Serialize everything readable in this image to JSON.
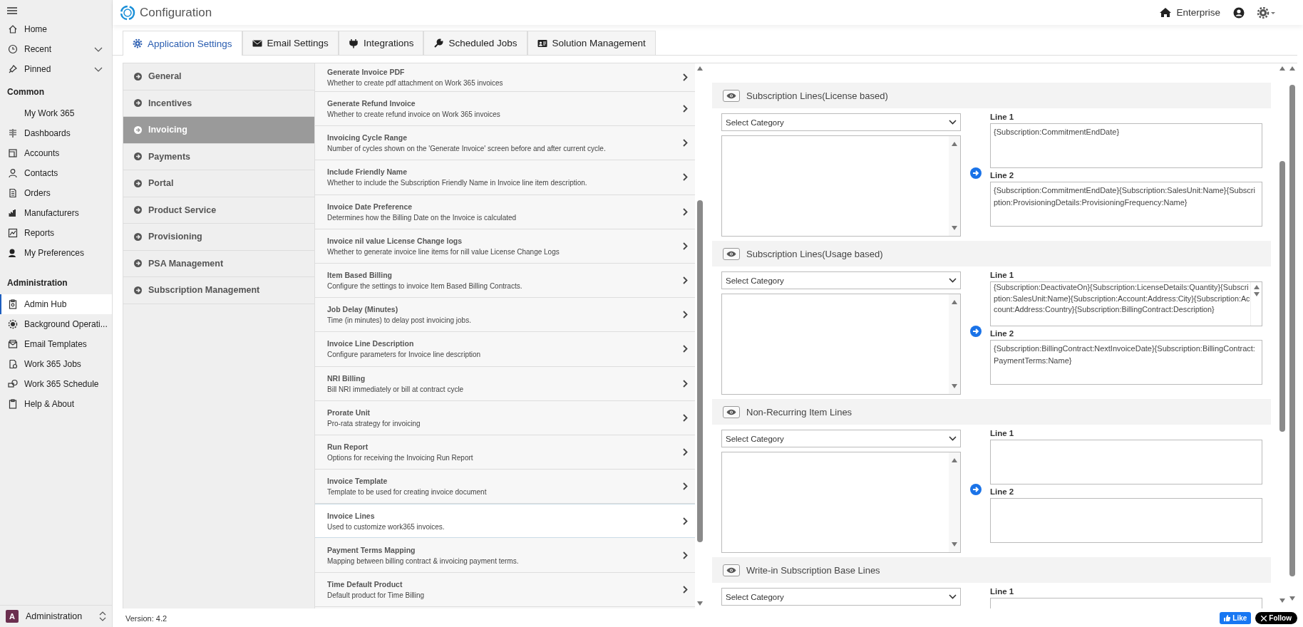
{
  "sidebar": {
    "top_items": [
      {
        "label": "Home"
      },
      {
        "label": "Recent",
        "expanded": false
      },
      {
        "label": "Pinned",
        "expanded": false
      }
    ],
    "groups": [
      {
        "title": "Common",
        "items": [
          {
            "label": "My Work 365",
            "selected": false
          },
          {
            "label": "Dashboards",
            "selected": false
          },
          {
            "label": "Accounts",
            "selected": false
          },
          {
            "label": "Contacts",
            "selected": false
          },
          {
            "label": "Orders",
            "selected": false
          },
          {
            "label": "Manufacturers",
            "selected": false
          },
          {
            "label": "Reports",
            "selected": false
          },
          {
            "label": "My Preferences",
            "selected": false
          }
        ]
      },
      {
        "title": "Administration",
        "items": [
          {
            "label": "Admin Hub",
            "selected": true
          },
          {
            "label": "Background Operati...",
            "selected": false
          },
          {
            "label": "Email Templates",
            "selected": false
          },
          {
            "label": "Work 365 Jobs",
            "selected": false
          },
          {
            "label": "Work 365 Schedule",
            "selected": false
          },
          {
            "label": "Help & About",
            "selected": false
          }
        ]
      }
    ],
    "area": {
      "initial": "A",
      "label": "Administration"
    }
  },
  "header": {
    "title": "Configuration",
    "environment": "Enterprise"
  },
  "tabs": [
    {
      "label": "Application Settings",
      "selected": true
    },
    {
      "label": "Email Settings",
      "selected": false
    },
    {
      "label": "Integrations",
      "selected": false
    },
    {
      "label": "Scheduled Jobs",
      "selected": false
    },
    {
      "label": "Solution Management",
      "selected": false
    }
  ],
  "categories": [
    {
      "label": "General",
      "selected": false
    },
    {
      "label": "Incentives",
      "selected": false
    },
    {
      "label": "Invoicing",
      "selected": true
    },
    {
      "label": "Payments",
      "selected": false
    },
    {
      "label": "Portal",
      "selected": false
    },
    {
      "label": "Product Service",
      "selected": false
    },
    {
      "label": "Provisioning",
      "selected": false
    },
    {
      "label": "PSA Management",
      "selected": false
    },
    {
      "label": "Subscription Management",
      "selected": false
    }
  ],
  "settings": [
    {
      "title": "Generate Invoice PDF",
      "description": "Whether to create pdf attachment on Work 365 invoices",
      "selected": false
    },
    {
      "title": "Generate Refund Invoice",
      "description": "Whether to create refund invoice on Work 365 invoices",
      "selected": false
    },
    {
      "title": "Invoicing Cycle Range",
      "description": "Number of cycles shown on the 'Generate Invoice' screen before and after current cycle.",
      "selected": false
    },
    {
      "title": "Include Friendly Name",
      "description": "Whether to include the Subscription Friendly Name in Invoice line item description.",
      "selected": false
    },
    {
      "title": "Invoice Date Preference",
      "description": "Determines how the Billing Date on the Invoice is calculated",
      "selected": false
    },
    {
      "title": "Invoice nil value License Change logs",
      "description": "Whether to generate invoice line items for nill value License Change Logs",
      "selected": false
    },
    {
      "title": "Item Based Billing",
      "description": "Configure the settings to invoice Item Based Billing Contracts.",
      "selected": false
    },
    {
      "title": "Job Delay (Minutes)",
      "description": "Time (in minutes) to delay post invoicing jobs.",
      "selected": false
    },
    {
      "title": "Invoice Line Description",
      "description": "Configure parameters for Invoice line description",
      "selected": false
    },
    {
      "title": "NRI Billing",
      "description": "Bill NRI immediately or bill at contract cycle",
      "selected": false
    },
    {
      "title": "Prorate Unit",
      "description": "Pro-rata strategy for invoicing",
      "selected": false
    },
    {
      "title": "Run Report",
      "description": "Options for receiving the Invoicing Run Report",
      "selected": false
    },
    {
      "title": "Invoice Template",
      "description": "Template to be used for creating invoice document",
      "selected": false
    },
    {
      "title": "Invoice Lines",
      "description": "Used to customize work365 invoices.",
      "selected": true
    },
    {
      "title": "Payment Terms Mapping",
      "description": "Mapping between billing contract & invoicing payment terms.",
      "selected": false
    },
    {
      "title": "Time Default Product",
      "description": "Default product for Time Billing",
      "selected": false
    }
  ],
  "line_sections": [
    {
      "title": "Subscription Lines(License based)",
      "category_placeholder": "Select Category",
      "lines": [
        {
          "label": "Line 1",
          "value": "{Subscription:CommitmentEndDate}"
        },
        {
          "label": "Line 2",
          "value": "{Subscription:CommitmentEndDate}{Subscription:SalesUnit:Name}{Subscription:ProvisioningDetails:ProvisioningFrequency:Name}"
        }
      ]
    },
    {
      "title": "Subscription Lines(Usage based)",
      "category_placeholder": "Select Category",
      "lines": [
        {
          "label": "Line 1",
          "value": "{Subscription:DeactivateOn}{Subscription:LicenseDetails:Quantity}{Subscription:SalesUnit:Name}{Subscription:Account:Address:City}{Subscription:Account:Address:Country}{Subscription:BillingContract:Description}",
          "scrollable": true
        },
        {
          "label": "Line 2",
          "value": "{Subscription:BillingContract:NextInvoiceDate}{Subscription:BillingContract:PaymentTerms:Name}"
        }
      ]
    },
    {
      "title": "Non-Recurring Item Lines",
      "category_placeholder": "Select Category",
      "lines": [
        {
          "label": "Line 1"
        },
        {
          "label": "Line 2"
        }
      ]
    },
    {
      "title": "Write-in Subscription Base Lines",
      "category_placeholder": "Select Category",
      "lines": [
        {
          "label": "Line 1"
        }
      ]
    }
  ],
  "footer": {
    "version": "Version: 4.2",
    "like": "Like",
    "follow": "Follow"
  }
}
